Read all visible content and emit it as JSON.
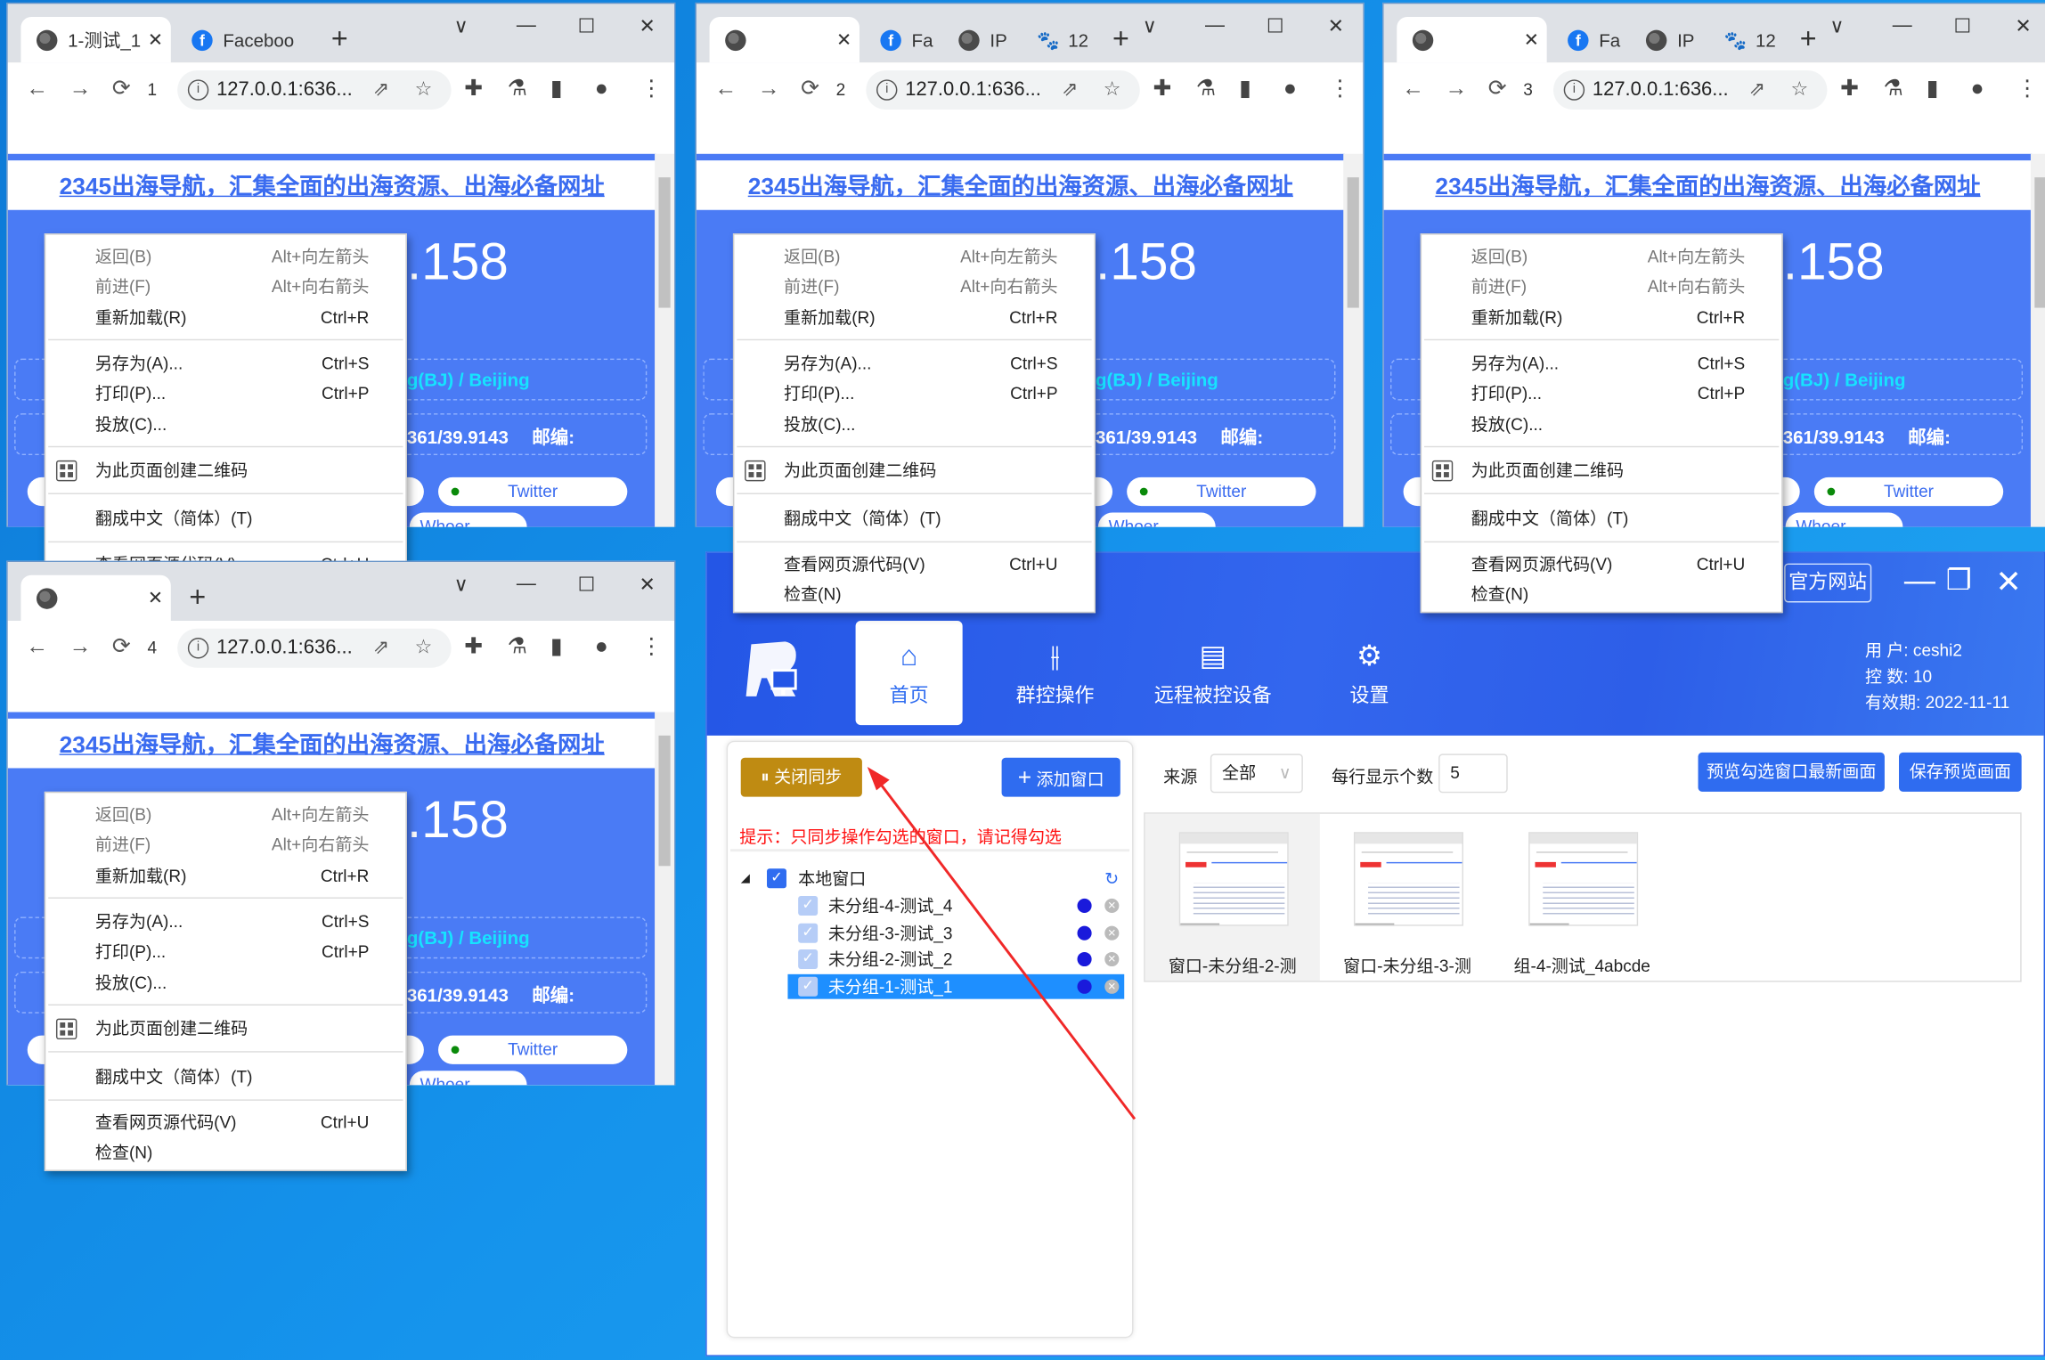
{
  "browsers": [
    {
      "tabs": [
        {
          "title": "1-测试_1",
          "icon": "globe-icon"
        },
        {
          "title": "Faceboo",
          "icon": "facebook-icon"
        }
      ],
      "profile": "1",
      "url": "127.0.0.1:636...",
      "heading": "2345出海导航，汇集全面的出海资源、出海必备网址",
      "ip_suffix": ".158",
      "location": "g(BJ) / Beijing",
      "coords": "361/39.9143",
      "postcode_label": "邮编:",
      "links": [
        "Twitter",
        "Whoer"
      ]
    },
    {
      "tabs": [
        {
          "title": "",
          "icon": "globe-icon"
        },
        {
          "title": "Fa",
          "icon": "facebook-icon"
        },
        {
          "title": "IP",
          "icon": "globe-icon"
        },
        {
          "title": "12",
          "icon": "paw-icon"
        }
      ],
      "profile": "2",
      "url": "127.0.0.1:636...",
      "heading": "2345出海导航，汇集全面的出海资源、出海必备网址",
      "ip_suffix": ".158",
      "location": "g(BJ) / Beijing",
      "coords": "361/39.9143",
      "postcode_label": "邮编:",
      "links": [
        "Twitter",
        "Whoer"
      ]
    },
    {
      "tabs": [
        {
          "title": "",
          "icon": "globe-icon"
        },
        {
          "title": "Fa",
          "icon": "facebook-icon"
        },
        {
          "title": "IP",
          "icon": "globe-icon"
        },
        {
          "title": "12",
          "icon": "paw-icon"
        }
      ],
      "profile": "3",
      "url": "127.0.0.1:636...",
      "heading": "2345出海导航，汇集全面的出海资源、出海必备网址",
      "ip_suffix": ".158",
      "location": "g(BJ) / Beijing",
      "coords": "361/39.9143",
      "postcode_label": "邮编:",
      "links": [
        "Twitter",
        "Whoer"
      ]
    },
    {
      "tabs": [
        {
          "title": "",
          "icon": "globe-icon"
        }
      ],
      "profile": "4",
      "url": "127.0.0.1:636...",
      "heading": "2345出海导航，汇集全面的出海资源、出海必备网址",
      "ip_suffix": ".158",
      "location": "g(BJ) / Beijing",
      "coords": "361/39.9143",
      "postcode_label": "邮编:",
      "links": [
        "Twitter",
        "Whoer"
      ]
    }
  ],
  "context_menu": [
    {
      "label": "返回(B)",
      "shortcut": "Alt+向左箭头",
      "disabled": true
    },
    {
      "label": "前进(F)",
      "shortcut": "Alt+向右箭头",
      "disabled": true
    },
    {
      "label": "重新加载(R)",
      "shortcut": "Ctrl+R"
    },
    {
      "label": "另存为(A)...",
      "shortcut": "Ctrl+S"
    },
    {
      "label": "打印(P)...",
      "shortcut": "Ctrl+P"
    },
    {
      "label": "投放(C)...",
      "shortcut": ""
    },
    {
      "label": "为此页面创建二维码",
      "shortcut": "",
      "icon": "qr-code-icon"
    },
    {
      "label": "翻成中文（简体）(T)",
      "shortcut": ""
    },
    {
      "label": "查看网页源代码(V)",
      "shortcut": "Ctrl+U"
    },
    {
      "label": "检查(N)",
      "shortcut": ""
    }
  ],
  "app": {
    "official_site": "官方网站",
    "nav": [
      {
        "label": "首页",
        "icon": "home-icon",
        "active": true
      },
      {
        "label": "群控操作",
        "icon": "sliders-icon"
      },
      {
        "label": "远程被控设备",
        "icon": "terminal-icon"
      },
      {
        "label": "设置",
        "icon": "gear-icon"
      }
    ],
    "user": {
      "user_label": "用  户:",
      "user": "ceshi2",
      "count_label": "控  数:",
      "count": "10",
      "expiry_label": "有效期:",
      "expiry": "2022-11-11"
    },
    "sync_button": "关闭同步",
    "add_window_button": "添加窗口",
    "hint": "提示：只同步操作勾选的窗口，请记得勾选",
    "tree": {
      "root": "本地窗口",
      "items": [
        {
          "label": "未分组-4-测试_4",
          "checked": true
        },
        {
          "label": "未分组-3-测试_3",
          "checked": true
        },
        {
          "label": "未分组-2-测试_2",
          "checked": true
        },
        {
          "label": "未分组-1-测试_1",
          "checked": true,
          "selected": true
        }
      ]
    },
    "source_label": "来源",
    "source_value": "全部",
    "per_row_label": "每行显示个数",
    "per_row_value": "5",
    "preview_button": "预览勾选窗口最新画面",
    "save_preview_button": "保存预览画面",
    "thumbnails": [
      "窗口-未分组-2-测",
      "窗口-未分组-3-测",
      "组-4-测试_4abcde"
    ],
    "colors": {
      "accent": "#2f6cf0",
      "sync": "#bf8b12",
      "hint": "#ff1111",
      "selected": "#1e8fff"
    }
  }
}
